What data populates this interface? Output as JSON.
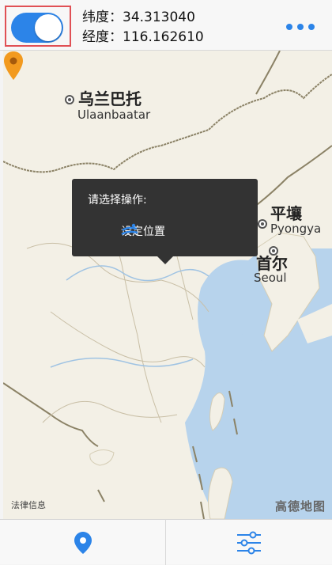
{
  "header": {
    "latitude_label": "纬度：",
    "latitude_value": "34.313040",
    "longitude_label": "经度：",
    "longitude_value": "116.162610",
    "toggle_on": true
  },
  "map": {
    "labels": {
      "ulaanbaatar_cn": "乌兰巴托",
      "ulaanbaatar_en": "Ulaanbaatar",
      "pyongyang_cn": "平壤",
      "pyongyang_en": "Pyongya",
      "seoul_cn": "首尔",
      "seoul_en": "Seoul"
    },
    "legal_text": "法律信息",
    "provider_logo": "高德地图"
  },
  "popup": {
    "title": "请选择操作:",
    "action_label": "设定位置"
  },
  "tabbar": {
    "left_icon": "location-pin-icon",
    "right_icon": "sliders-icon"
  },
  "colors": {
    "accent": "#2c84e8",
    "pin": "#f29a1f",
    "popup_bg": "#333333",
    "sea": "#b7d3ec",
    "land": "#f3f0e6",
    "highlight_frame": "#e05055"
  }
}
